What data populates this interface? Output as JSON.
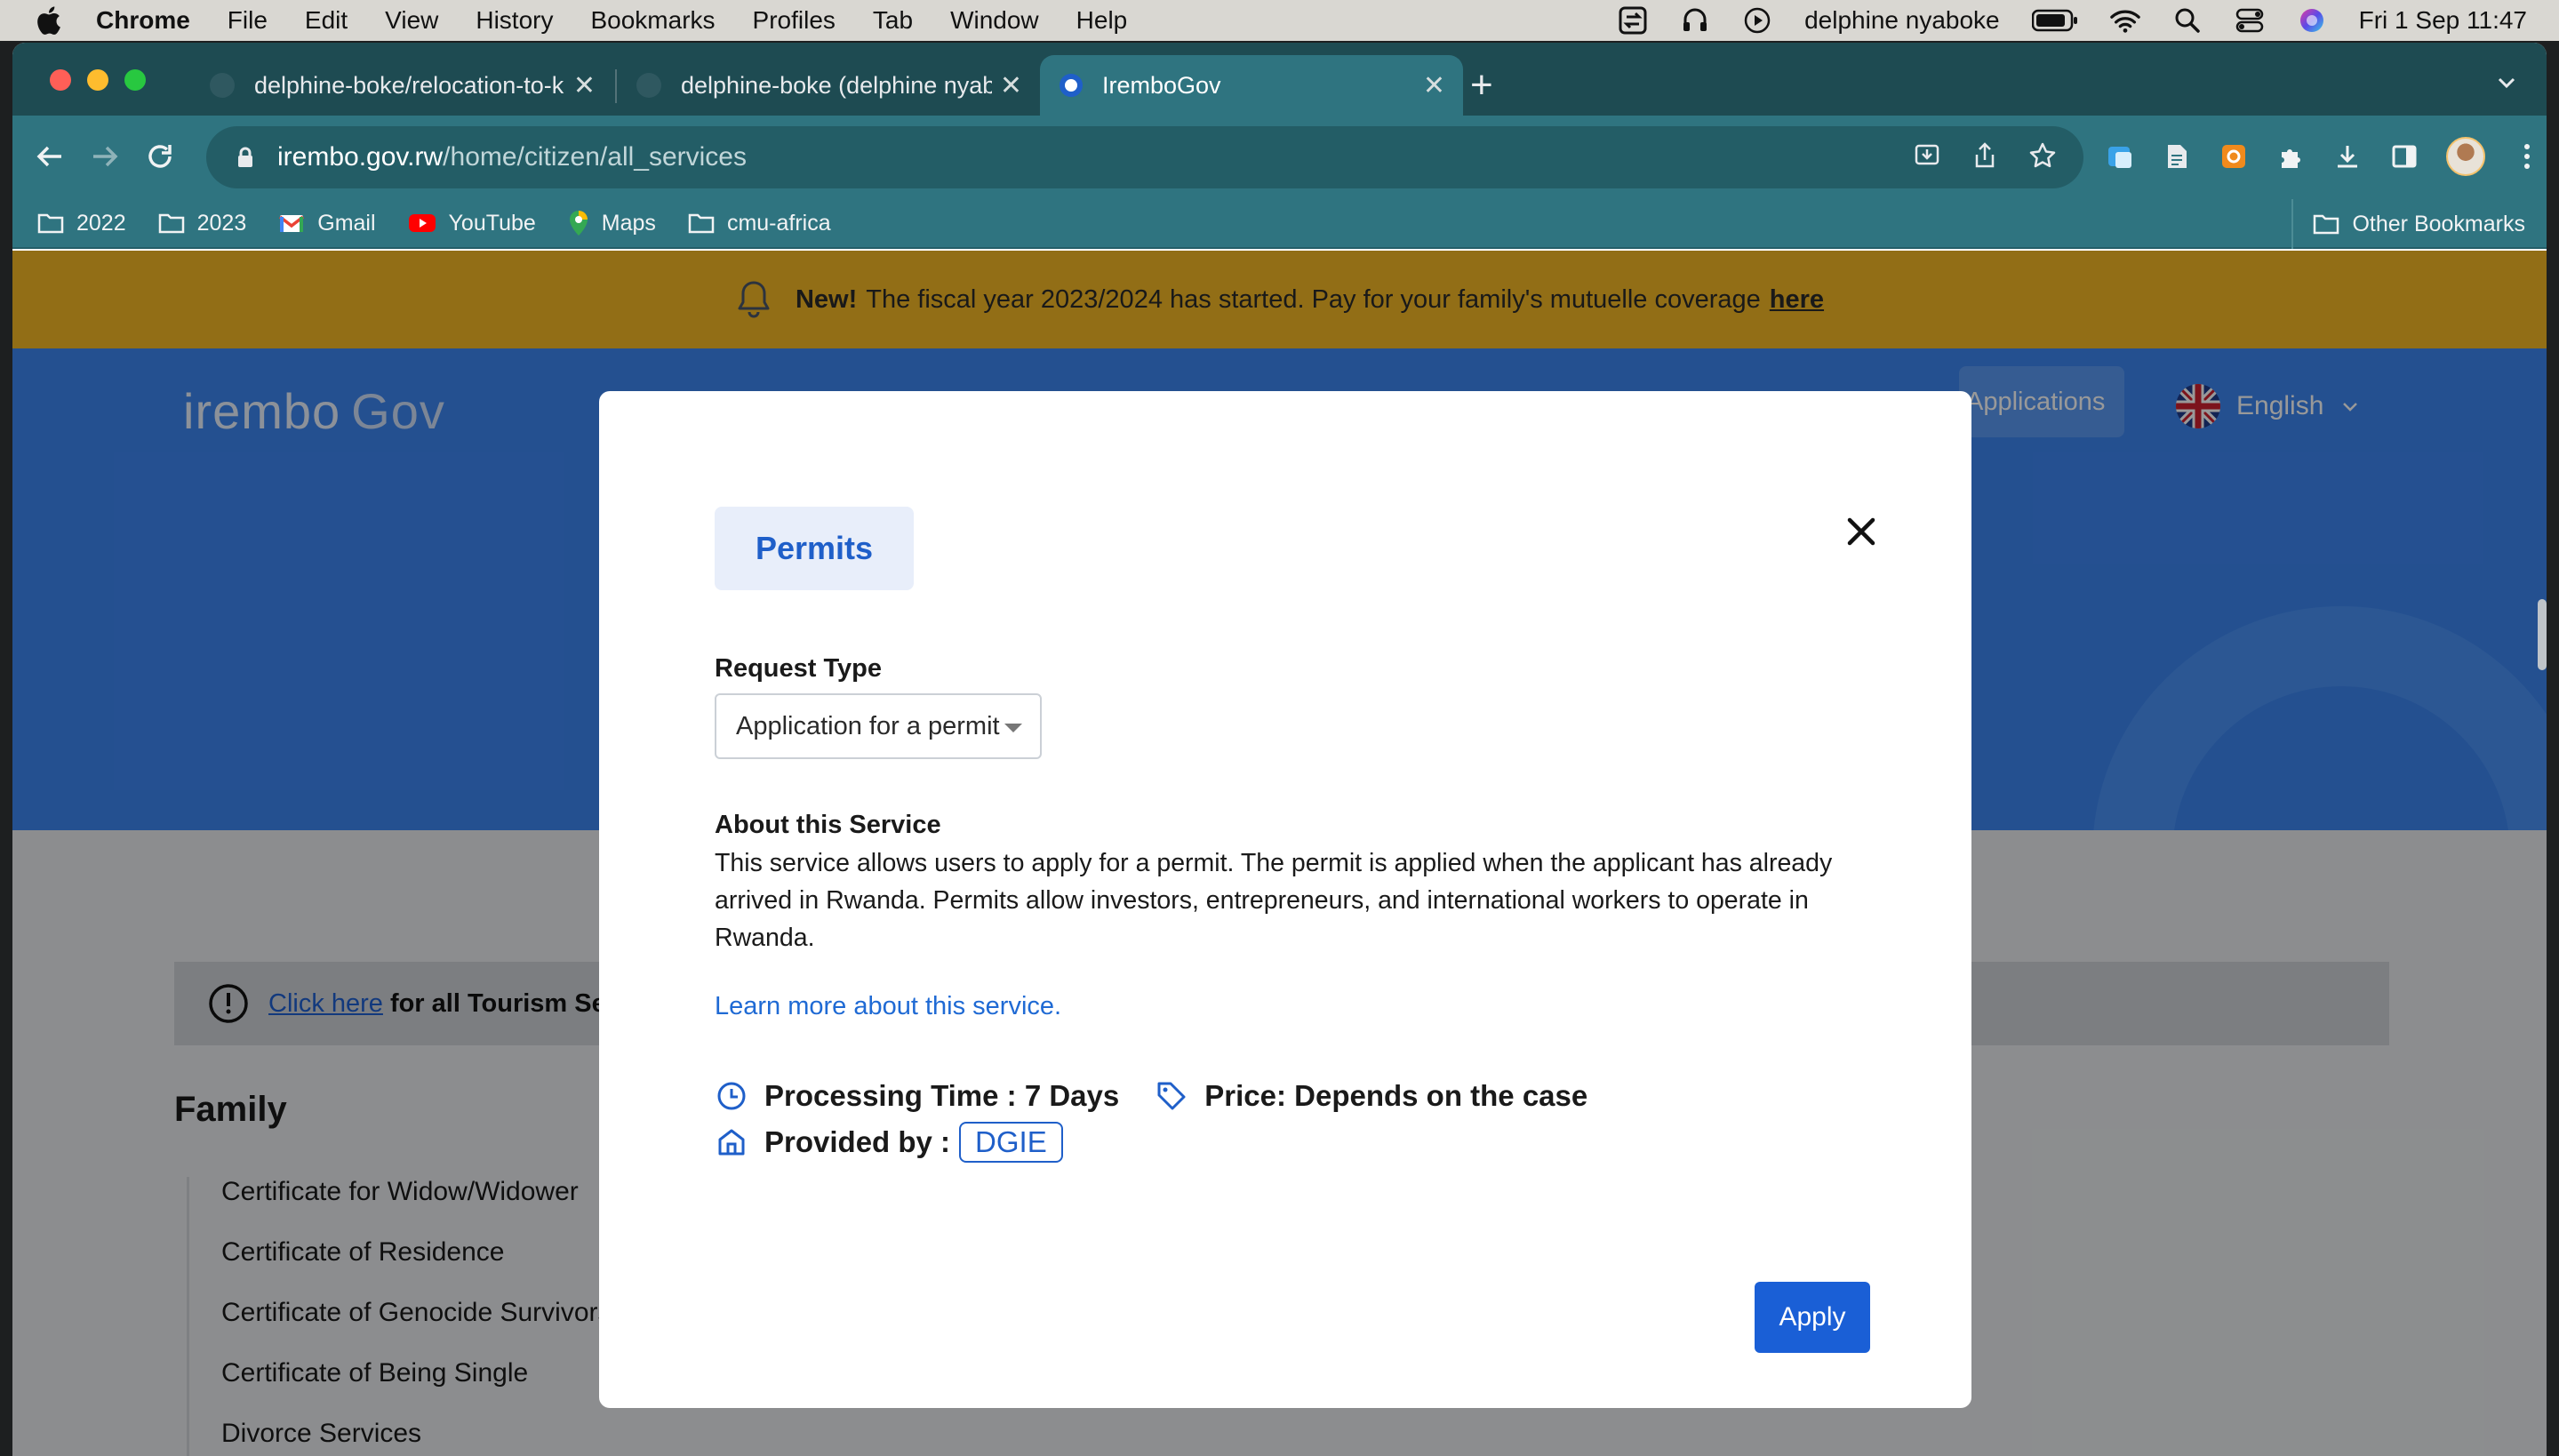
{
  "menubar": {
    "app": "Chrome",
    "items": [
      "File",
      "Edit",
      "View",
      "History",
      "Bookmarks",
      "Profiles",
      "Tab",
      "Window",
      "Help"
    ],
    "user": "delphine nyaboke",
    "datetime": "Fri 1 Sep  11:47"
  },
  "tabs": [
    {
      "title": "delphine-boke/relocation-to-ki",
      "close": "✕"
    },
    {
      "title": "delphine-boke (delphine nyabo",
      "close": "✕"
    },
    {
      "title": "IremboGov",
      "close": "✕"
    }
  ],
  "newtab": "+",
  "omnibox": {
    "host": "irembo.gov.rw",
    "path": "/home/citizen/all_services"
  },
  "bookmarks": {
    "items": [
      {
        "label": "2022",
        "icon": "folder-icon"
      },
      {
        "label": "2023",
        "icon": "folder-icon"
      },
      {
        "label": "Gmail",
        "icon": "gmail-icon"
      },
      {
        "label": "YouTube",
        "icon": "youtube-icon"
      },
      {
        "label": "Maps",
        "icon": "maps-icon"
      },
      {
        "label": "cmu-africa",
        "icon": "folder-icon"
      }
    ],
    "other": "Other Bookmarks"
  },
  "notice": {
    "badge": "New!",
    "text": "The fiscal year 2023/2024 has started. Pay for your family's mutuelle coverage",
    "link": "here"
  },
  "header": {
    "logo": "irembo",
    "logo_suffix": "Gov",
    "applications": "Applications",
    "language": "English"
  },
  "tourism": {
    "link": "Click here",
    "text": "for all Tourism Services"
  },
  "family": {
    "title": "Family",
    "services": [
      "Certificate for Widow/Widower",
      "Certificate of Residence",
      "Certificate of Genocide Survivors",
      "Certificate of Being Single",
      "Divorce Services"
    ]
  },
  "modal": {
    "category": "Permits",
    "request_type_label": "Request Type",
    "request_type_value": "Application for a permit",
    "about_title": "About this Service",
    "about_text": "This service allows users to apply for a permit. The permit is applied when the applicant has already arrived in Rwanda. Permits allow investors, entrepreneurs, and international workers to operate in Rwanda.",
    "learn_more": "Learn more about this service.",
    "processing_time": "Processing Time : 7 Days",
    "price": "Price: Depends on the case",
    "provided_by_label": "Provided by :",
    "provider": "DGIE",
    "apply": "Apply"
  },
  "colors": {
    "tab_active": "#2f7480",
    "tabstrip": "#1e4b52",
    "notice": "#f3b826",
    "hero": "#3d86f1",
    "primary": "#1a5fd6"
  }
}
